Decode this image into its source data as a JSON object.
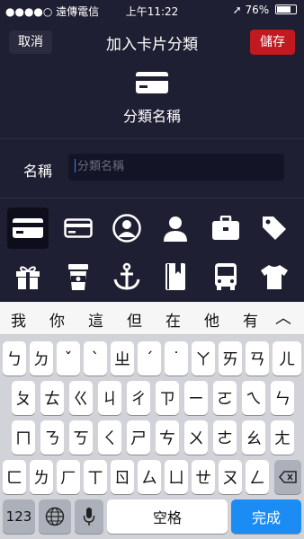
{
  "status": {
    "carrier": "●●●●○ 遠傳電信",
    "time": "上午11:22",
    "battery": "76%",
    "battery_level": 0.76
  },
  "nav": {
    "cancel": "取消",
    "title": "加入卡片分類",
    "save": "儲存"
  },
  "hero": {
    "label": "分類名稱",
    "icon": "credit-card-icon"
  },
  "name_field": {
    "label": "名稱",
    "placeholder": "分類名稱"
  },
  "icons": {
    "row1": [
      "credit-card-icon",
      "credit-card-outline-icon",
      "person-circle-icon",
      "person-icon",
      "briefcase-icon",
      "tag-icon"
    ],
    "row2": [
      "gift-icon",
      "coffee-cup-icon",
      "anchor-icon",
      "book-icon",
      "bus-icon",
      "tshirt-icon"
    ],
    "selected": "credit-card-icon"
  },
  "keyboard": {
    "candidates": [
      "我",
      "你",
      "這",
      "但",
      "在",
      "他",
      "有"
    ],
    "row1": [
      "ㄅ",
      "ㄉ",
      "ˇ",
      "ˋ",
      "ㄓ",
      "ˊ",
      "˙",
      "ㄚ",
      "ㄞ",
      "ㄢ",
      "ㄦ"
    ],
    "row2": [
      "ㄆ",
      "ㄊ",
      "ㄍ",
      "ㄐ",
      "ㄔ",
      "ㄗ",
      "ㄧ",
      "ㄛ",
      "ㄟ",
      "ㄣ"
    ],
    "row3": [
      "ㄇ",
      "ㄋ",
      "ㄎ",
      "ㄑ",
      "ㄕ",
      "ㄘ",
      "ㄨ",
      "ㄜ",
      "ㄠ",
      "ㄤ"
    ],
    "row4": [
      "ㄈ",
      "ㄌ",
      "ㄏ",
      "ㄒ",
      "ㄖ",
      "ㄙ",
      "ㄩ",
      "ㄝ",
      "ㄡ",
      "ㄥ"
    ],
    "num": "123",
    "space": "空格",
    "done": "完成"
  }
}
